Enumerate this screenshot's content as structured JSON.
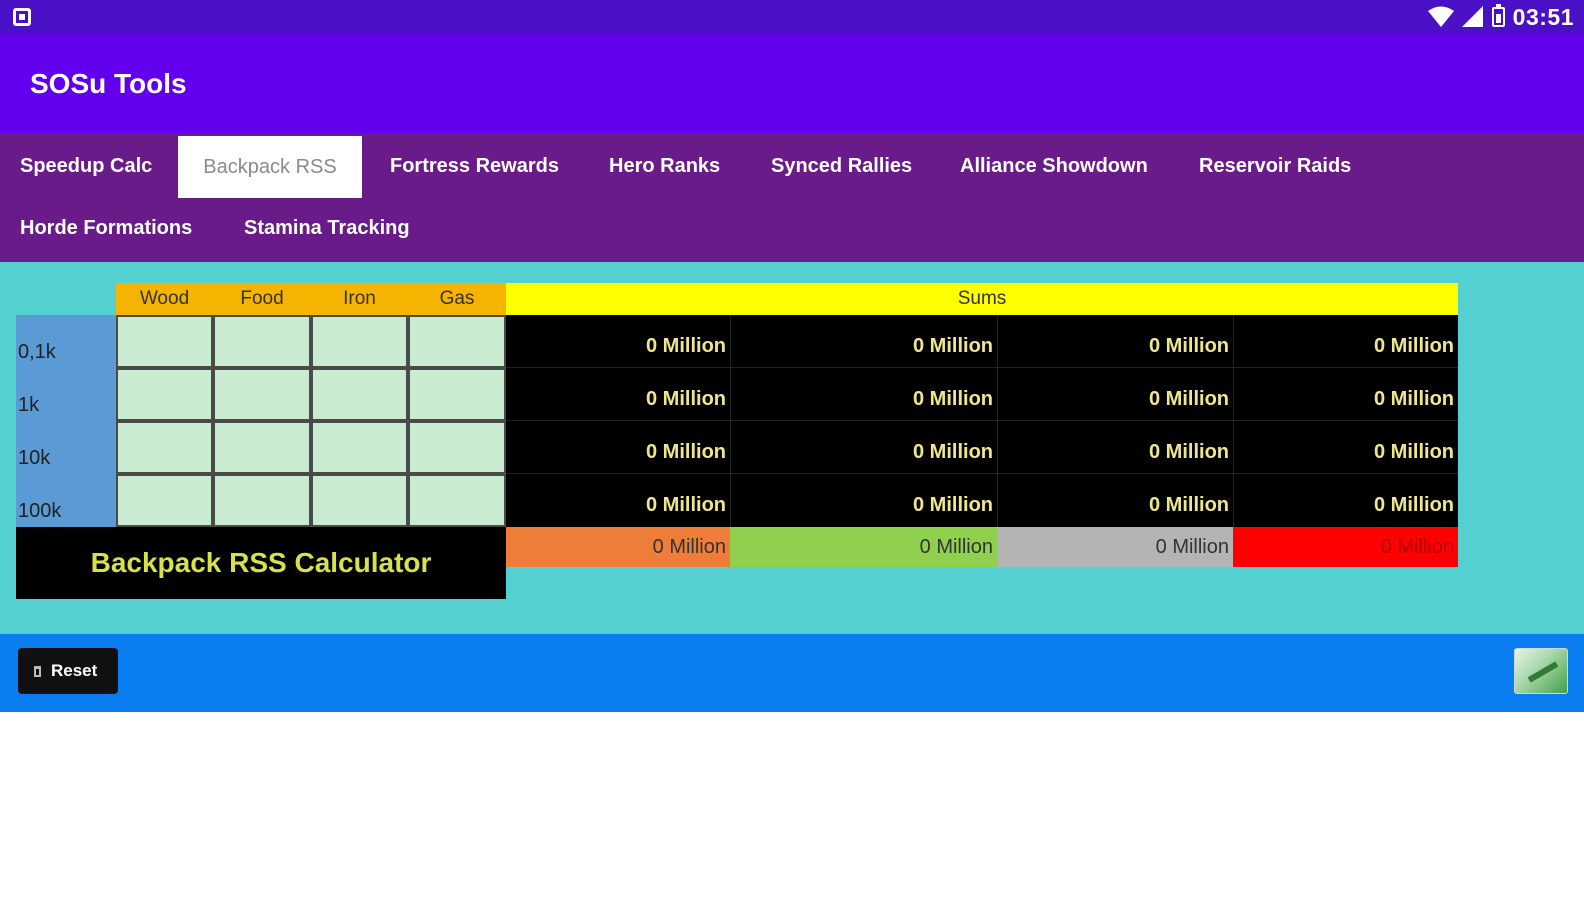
{
  "status_bar": {
    "time": "03:51"
  },
  "app": {
    "title": "SOSu Tools"
  },
  "tabs": [
    {
      "label": "Speedup Calc",
      "active": false
    },
    {
      "label": "Backpack RSS",
      "active": true
    },
    {
      "label": "Fortress Rewards",
      "active": false
    },
    {
      "label": "Hero Ranks",
      "active": false
    },
    {
      "label": "Synced Rallies",
      "active": false
    },
    {
      "label": "Alliance Showdown",
      "active": false
    },
    {
      "label": "Reservoir Raids",
      "active": false
    },
    {
      "label": "Horde Formations",
      "active": false
    },
    {
      "label": "Stamina Tracking",
      "active": false
    }
  ],
  "calculator": {
    "columns": [
      "Wood",
      "Food",
      "Iron",
      "Gas"
    ],
    "sums_header": "Sums",
    "rows": [
      {
        "label": "0,1k",
        "sums": [
          "0 Million",
          "0 Million",
          "0 Million",
          "0 Million"
        ]
      },
      {
        "label": "1k",
        "sums": [
          "0 Million",
          "0 Million",
          "0 Million",
          "0 Million"
        ]
      },
      {
        "label": "10k",
        "sums": [
          "0 Million",
          "0 Million",
          "0 Million",
          "0 Million"
        ]
      },
      {
        "label": "100k",
        "sums": [
          "0 Million",
          "0 Million",
          "0 Million",
          "0 Million"
        ]
      }
    ],
    "totals": [
      {
        "value": "0 Million",
        "bg": "#ef7d3a",
        "color": "#333333"
      },
      {
        "value": "0 Million",
        "bg": "#8fd14f",
        "color": "#333333"
      },
      {
        "value": "0 Million",
        "bg": "#b4b4b4",
        "color": "#333333"
      },
      {
        "value": "0 Million",
        "bg": "#ff0000",
        "color": "#b00000"
      }
    ],
    "title": "Backpack RSS Calculator"
  },
  "bottom_bar": {
    "reset_label": "Reset",
    "reset_icon": "trash-icon",
    "calc_icon": "calculator-icon"
  },
  "colors": {
    "status_bar": "#4a10c6",
    "app_bar": "#6200ee",
    "tab_bar": "#6a1b8a",
    "content_bg": "#55d0d0",
    "column_header": "#f5b400",
    "sums_header": "#ffff00",
    "row_label_col": "#5b9bd5",
    "input_cell": "#c9ecd0",
    "sum_text": "#f0e68c",
    "bottom_bar": "#0a7ef0"
  }
}
